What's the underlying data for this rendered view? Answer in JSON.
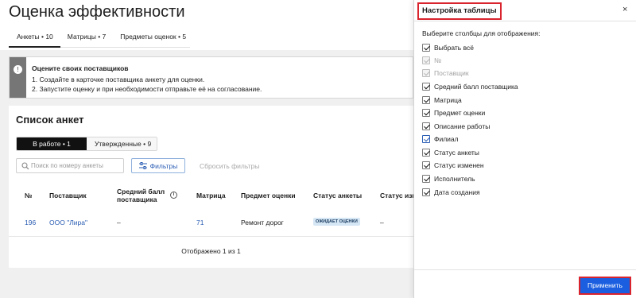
{
  "page": {
    "title": "Оценка эффективности",
    "tabs": [
      {
        "label": "Анкеты • 10"
      },
      {
        "label": "Матрицы • 7"
      },
      {
        "label": "Предметы оценок • 5"
      }
    ]
  },
  "info": {
    "title": "Оцените своих поставщиков",
    "line1": "1. Создайте в карточке поставщика анкету для оценки.",
    "line2": "2. Запустите оценку и при необходимости отправьте её на согласование."
  },
  "list": {
    "title": "Список анкет",
    "segments": [
      {
        "label": "В работе • 1"
      },
      {
        "label": "Утвержденные • 9"
      }
    ],
    "search_placeholder": "Поиск по номеру анкеты",
    "filters_label": "Фильтры",
    "reset_label": "Сбросить фильтры",
    "columns": {
      "num": "№",
      "supplier": "Поставщик",
      "avg_l1": "Средний балл",
      "avg_l2": "поставщика",
      "matrix": "Матрица",
      "subject": "Предмет оценки",
      "status": "Статус анкеты",
      "status_changed": "Статус изм"
    },
    "row": {
      "num": "196",
      "supplier": "ООО \"Лира\"",
      "avg": "–",
      "matrix": "71",
      "subject": "Ремонт дорог",
      "status": "ОЖИДАЕТ ОЦЕНКИ",
      "status_changed": "–"
    },
    "pager": "Отображено 1 из 1"
  },
  "panel": {
    "title": "Настройка таблицы",
    "close": "×",
    "subtitle": "Выберите столбцы для отображения:",
    "options": [
      {
        "label": "Выбрать всё",
        "checked": true,
        "disabled": false
      },
      {
        "label": "№",
        "checked": true,
        "disabled": true
      },
      {
        "label": "Поставщик",
        "checked": true,
        "disabled": true
      },
      {
        "label": "Средний балл поставщика",
        "checked": true,
        "disabled": false
      },
      {
        "label": "Матрица",
        "checked": true,
        "disabled": false
      },
      {
        "label": "Предмет оценки",
        "checked": true,
        "disabled": false
      },
      {
        "label": "Описание работы",
        "checked": true,
        "disabled": false
      },
      {
        "label": "Филиал",
        "checked": true,
        "disabled": false
      },
      {
        "label": "Статус анкеты",
        "checked": true,
        "disabled": false
      },
      {
        "label": "Статус изменен",
        "checked": true,
        "disabled": false
      },
      {
        "label": "Исполнитель",
        "checked": true,
        "disabled": false
      },
      {
        "label": "Дата создания",
        "checked": true,
        "disabled": false
      }
    ],
    "apply": "Применить"
  },
  "colors": {
    "accent": "#2a5db3",
    "apply_bg": "#1b5fe0",
    "highlight": "#d9232d"
  }
}
